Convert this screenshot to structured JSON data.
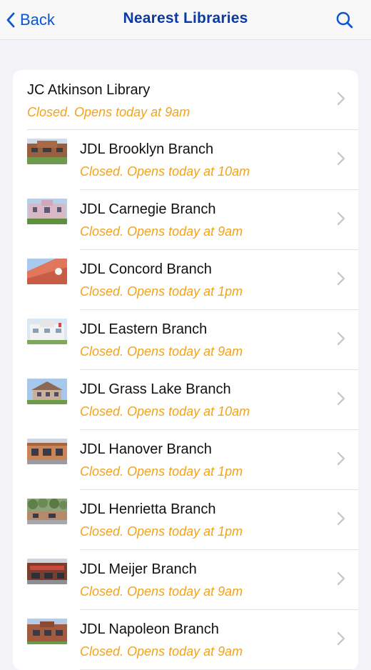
{
  "nav": {
    "back_label": "Back",
    "title": "Nearest Libraries",
    "search_icon": "search-icon",
    "back_icon": "chevron-left-icon"
  },
  "colors": {
    "accent": "#0A56D1",
    "title": "#0A3AA5",
    "status": "#F2A31A",
    "background": "#F2F2F7"
  },
  "libraries": [
    {
      "name": "JC Atkinson Library",
      "status": "Closed. Opens today at 9am",
      "thumb": ""
    },
    {
      "name": "JDL Brooklyn Branch",
      "status": "Closed. Opens today at 10am",
      "thumb": "brick-building"
    },
    {
      "name": "JDL Carnegie Branch",
      "status": "Closed. Opens today at 9am",
      "thumb": "pink-building"
    },
    {
      "name": "JDL Concord Branch",
      "status": "Closed. Opens today at 1pm",
      "thumb": "orange-wall"
    },
    {
      "name": "JDL Eastern Branch",
      "status": "Closed. Opens today at 9am",
      "thumb": "white-building"
    },
    {
      "name": "JDL Grass Lake Branch",
      "status": "Closed. Opens today at 10am",
      "thumb": "brick-house"
    },
    {
      "name": "JDL Hanover Branch",
      "status": "Closed. Opens today at 1pm",
      "thumb": "storefront"
    },
    {
      "name": "JDL Henrietta Branch",
      "status": "Closed. Opens today at 1pm",
      "thumb": "trees-building"
    },
    {
      "name": "JDL Meijer Branch",
      "status": "Closed. Opens today at 9am",
      "thumb": "meijer-storefront"
    },
    {
      "name": "JDL Napoleon Branch",
      "status": "Closed. Opens today at 9am",
      "thumb": "brick-library"
    }
  ]
}
